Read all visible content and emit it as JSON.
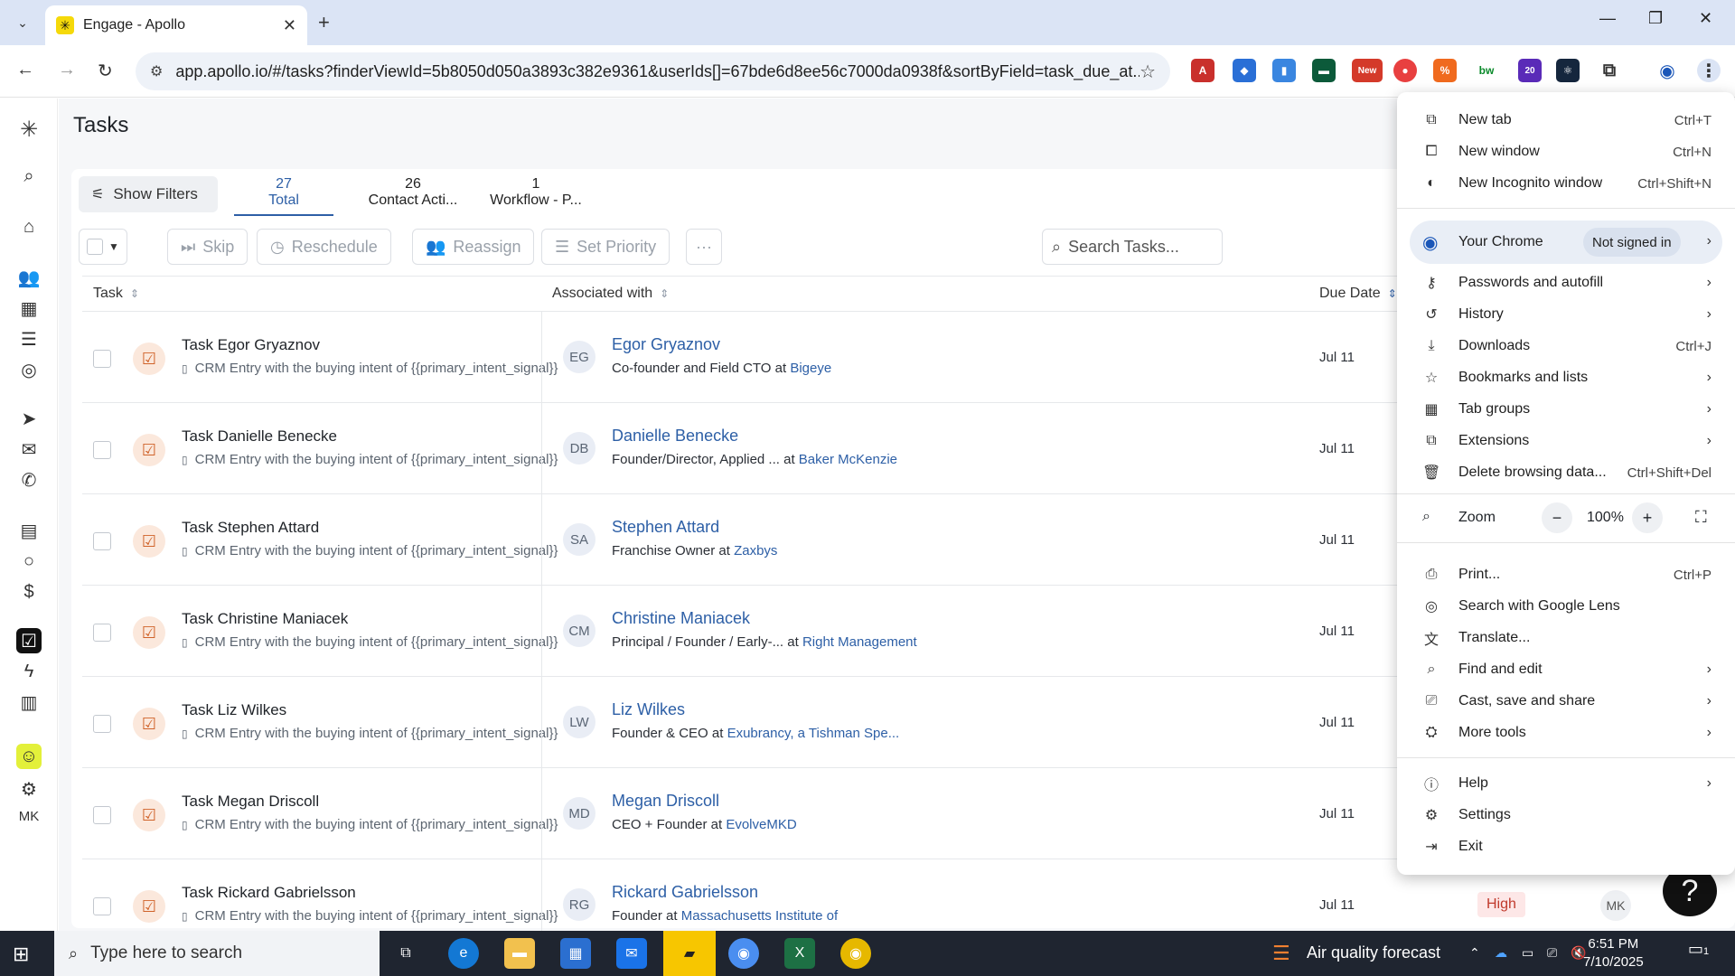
{
  "browser": {
    "tab_title": "Engage - Apollo",
    "url": "app.apollo.io/#/tasks?finderViewId=5b8050d050a3893c382e9361&userIds[]=67bde6d8ee56c7000da0938f&sortByField=task_due_at...",
    "new_badge": "New",
    "ext_badge": "20"
  },
  "page": {
    "title": "Tasks",
    "show_filters": "Show Filters",
    "tabs": [
      {
        "count": "27",
        "label": "Total"
      },
      {
        "count": "26",
        "label": "Contact Acti..."
      },
      {
        "count": "1",
        "label": "Workflow - P..."
      }
    ],
    "actions": {
      "skip": "Skip",
      "reschedule": "Reschedule",
      "reassign": "Reassign",
      "set_priority": "Set Priority",
      "more": "···"
    },
    "search_placeholder": "Search Tasks...",
    "columns": {
      "task": "Task",
      "associated": "Associated with",
      "due": "Due Date"
    },
    "owner_initials": "MK"
  },
  "rows": [
    {
      "task": "Task Egor Gryaznov",
      "sub": "CRM Entry with the buying intent of {{primary_intent_signal}}",
      "initials": "EG",
      "name": "Egor Gryaznov",
      "role": "Co-founder and Field CTO",
      "at": "at",
      "company": "Bigeye",
      "due": "Jul 11"
    },
    {
      "task": "Task Danielle Benecke",
      "sub": "CRM Entry with the buying intent of {{primary_intent_signal}}",
      "initials": "DB",
      "name": "Danielle Benecke",
      "role": "Founder/Director, Applied ...",
      "at": "at",
      "company": "Baker McKenzie",
      "due": "Jul 11"
    },
    {
      "task": "Task Stephen Attard",
      "sub": "CRM Entry with the buying intent of {{primary_intent_signal}}",
      "initials": "SA",
      "name": "Stephen Attard",
      "role": "Franchise Owner",
      "at": "at",
      "company": "Zaxbys",
      "due": "Jul 11"
    },
    {
      "task": "Task Christine Maniacek",
      "sub": "CRM Entry with the buying intent of {{primary_intent_signal}}",
      "initials": "CM",
      "name": "Christine Maniacek",
      "role": "Principal / Founder / Early-...",
      "at": "at",
      "company": "Right Management",
      "due": "Jul 11"
    },
    {
      "task": "Task Liz Wilkes",
      "sub": "CRM Entry with the buying intent of {{primary_intent_signal}}",
      "initials": "LW",
      "name": "Liz Wilkes",
      "role": "Founder & CEO",
      "at": "at",
      "company": "Exubrancy, a Tishman Spe...",
      "due": "Jul 11"
    },
    {
      "task": "Task Megan Driscoll",
      "sub": "CRM Entry with the buying intent of {{primary_intent_signal}}",
      "initials": "MD",
      "name": "Megan Driscoll",
      "role": "CEO + Founder",
      "at": "at",
      "company": "EvolveMKD",
      "due": "Jul 11"
    },
    {
      "task": "Task Rickard Gabrielsson",
      "sub": "CRM Entry with the buying intent of {{primary_intent_signal}}",
      "initials": "RG",
      "name": "Rickard Gabrielsson",
      "role": "Founder",
      "at": "at",
      "company": "Massachusetts Institute of",
      "due": "Jul 11",
      "priority": "High",
      "owner": "MK"
    }
  ],
  "menu": {
    "new_tab": "New tab",
    "new_tab_sc": "Ctrl+T",
    "new_window": "New window",
    "new_window_sc": "Ctrl+N",
    "incognito": "New Incognito window",
    "incognito_sc": "Ctrl+Shift+N",
    "your_chrome": "Your Chrome",
    "not_signed_in": "Not signed in",
    "passwords": "Passwords and autofill",
    "history": "History",
    "downloads": "Downloads",
    "downloads_sc": "Ctrl+J",
    "bookmarks": "Bookmarks and lists",
    "tab_groups": "Tab groups",
    "extensions": "Extensions",
    "delete_data": "Delete browsing data...",
    "delete_data_sc": "Ctrl+Shift+Del",
    "zoom": "Zoom",
    "zoom_level": "100%",
    "zoom_minus": "−",
    "zoom_plus": "+",
    "print": "Print...",
    "print_sc": "Ctrl+P",
    "lens": "Search with Google Lens",
    "translate": "Translate...",
    "find_edit": "Find and edit",
    "cast": "Cast, save and share",
    "more_tools": "More tools",
    "help": "Help",
    "settings": "Settings",
    "exit": "Exit"
  },
  "taskbar": {
    "search_placeholder": "Type here to search",
    "weather": "Air quality forecast",
    "time": "6:51 PM",
    "date": "7/10/2025",
    "notif_count": "1"
  }
}
